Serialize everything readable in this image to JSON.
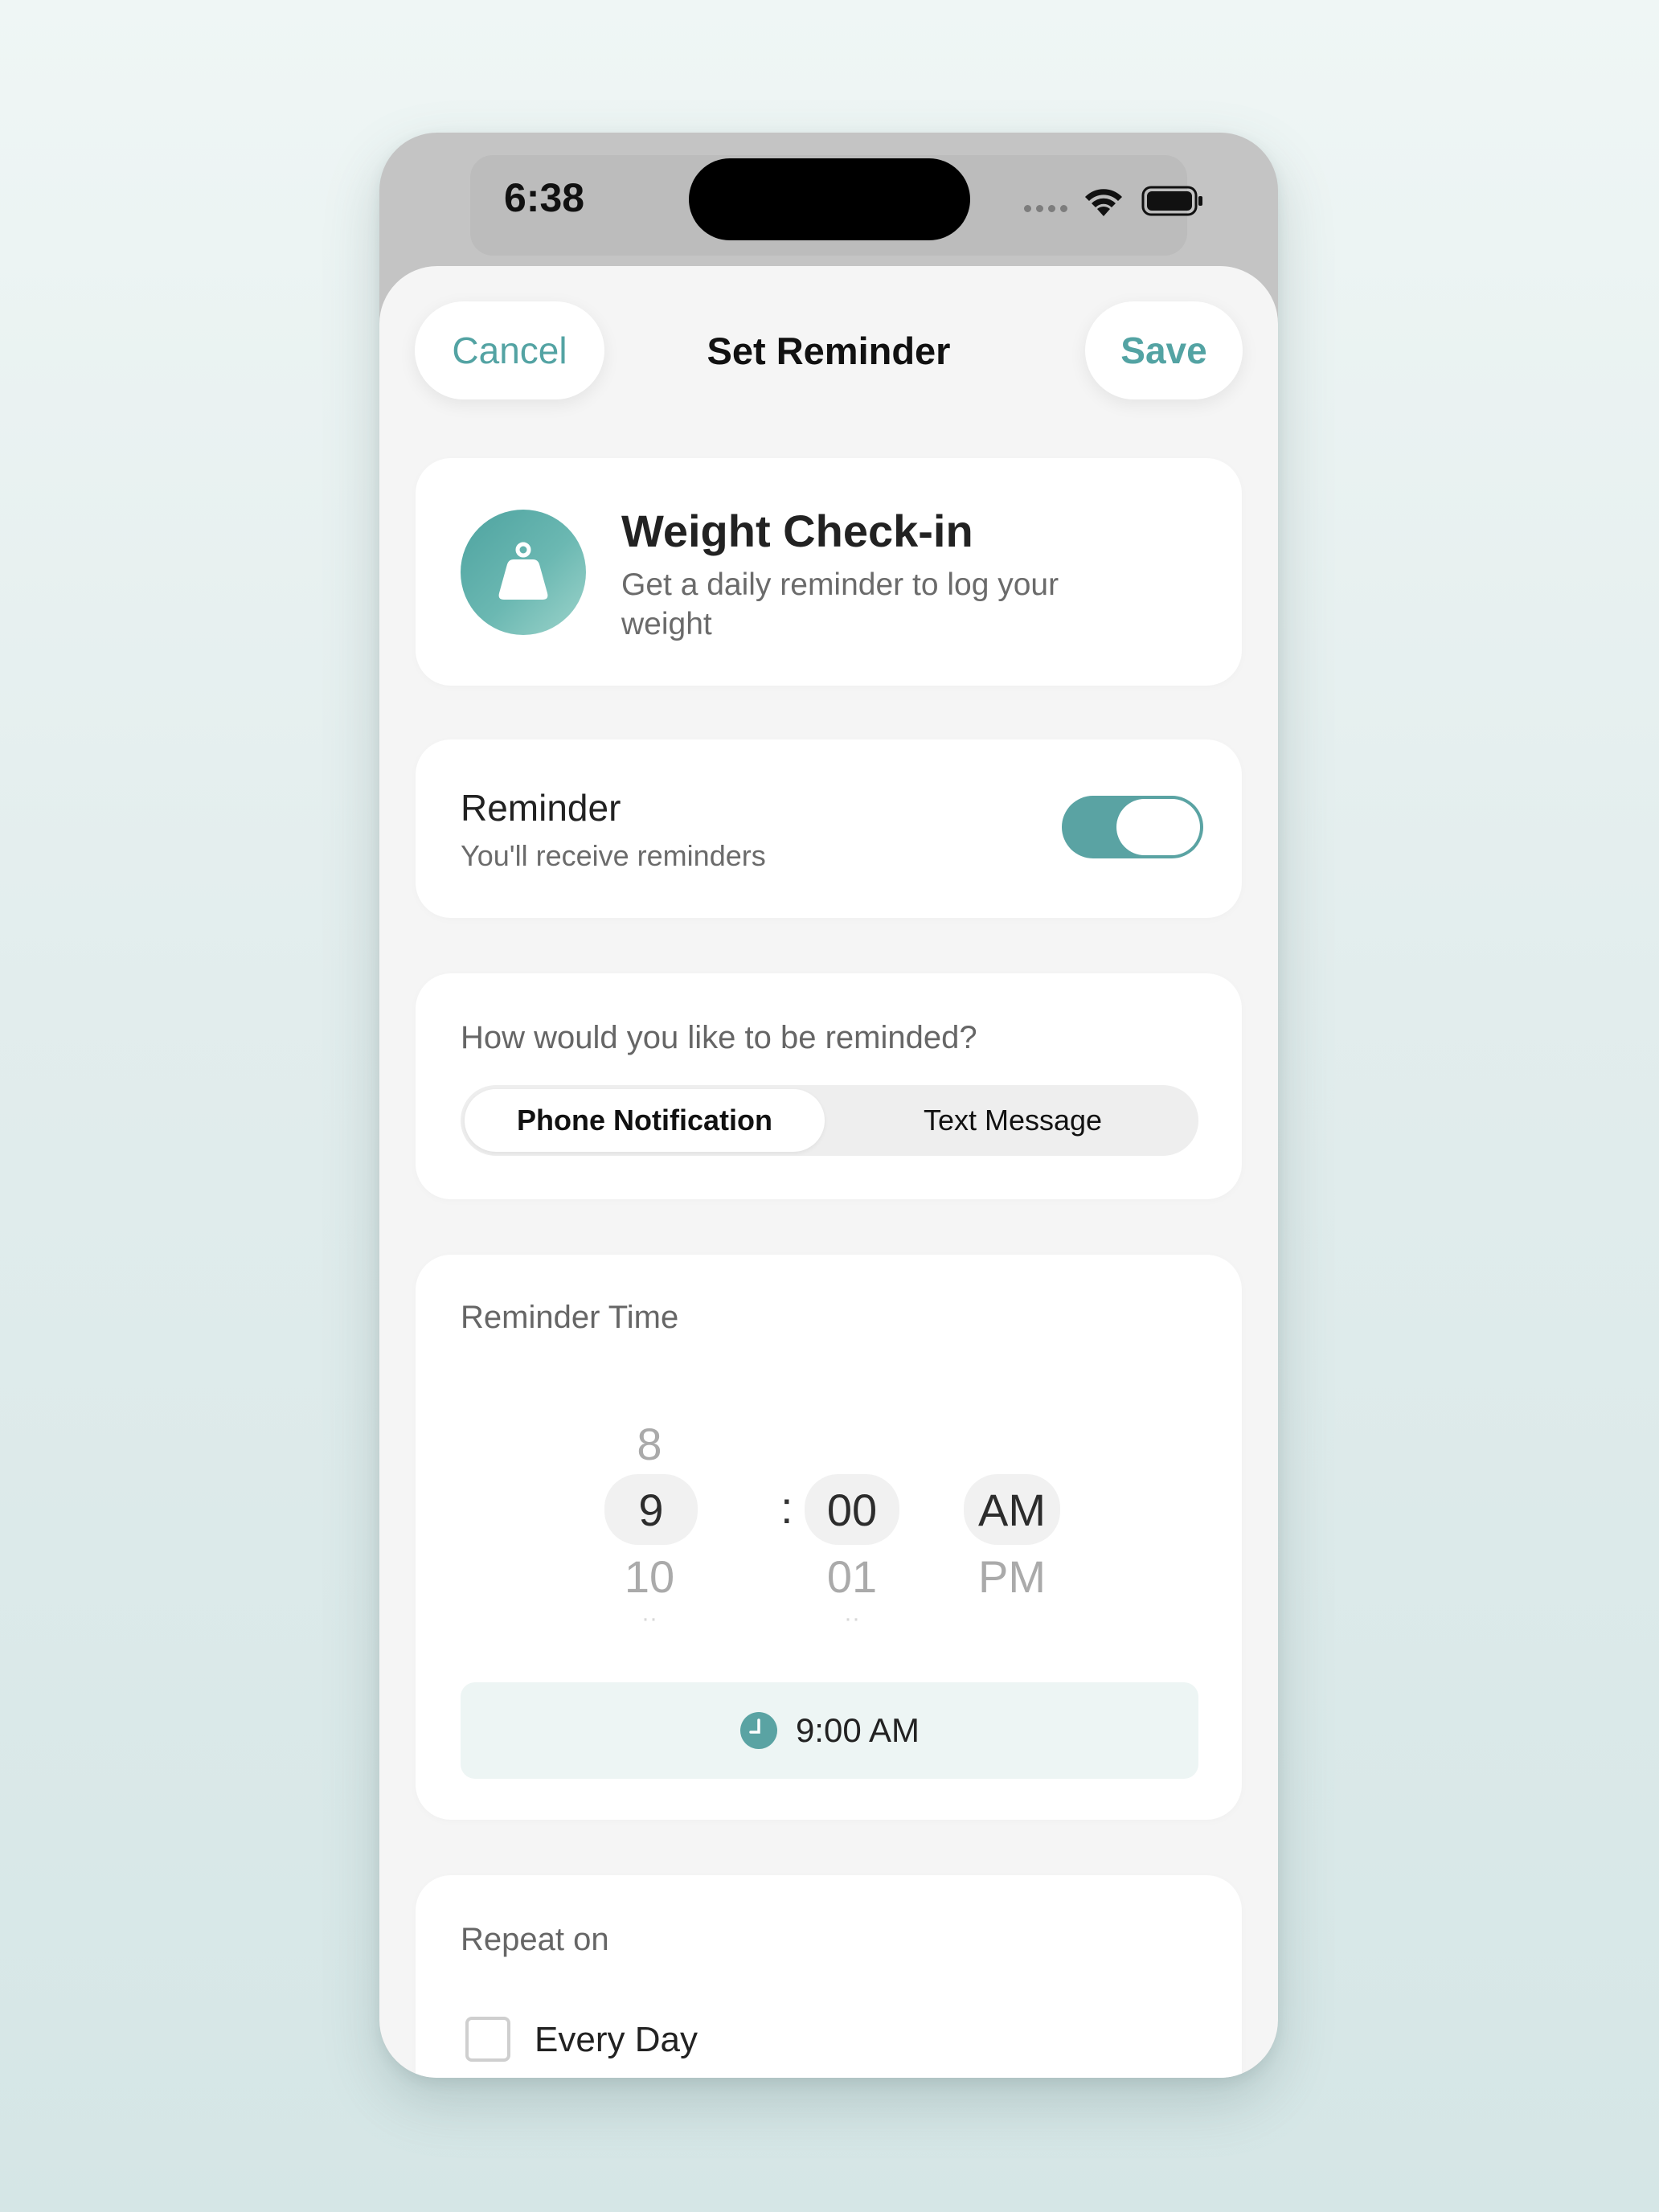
{
  "status_bar": {
    "time": "6:38"
  },
  "nav": {
    "cancel_label": "Cancel",
    "title": "Set Reminder",
    "save_label": "Save"
  },
  "header_card": {
    "icon": "weight-scale-icon",
    "title": "Weight Check-in",
    "subtitle": "Get a daily reminder to log your weight"
  },
  "reminder_toggle": {
    "title": "Reminder",
    "subtitle": "You'll receive reminders",
    "enabled": true
  },
  "method": {
    "question": "How would you like to be reminded?",
    "options": [
      "Phone Notification",
      "Text Message"
    ],
    "selected": "Phone Notification"
  },
  "reminder_time": {
    "label": "Reminder Time",
    "hour": {
      "above": "8",
      "selected": "9",
      "below": "10"
    },
    "separator": ":",
    "minute": {
      "selected": "00",
      "below": "01"
    },
    "period": {
      "selected": "AM",
      "below": "PM"
    },
    "summary": "9:00 AM"
  },
  "repeat": {
    "label": "Repeat on",
    "every_day_label": "Every Day",
    "every_day_checked": false
  },
  "colors": {
    "accent": "#5aa3a3",
    "background": "#f5f5f5"
  }
}
